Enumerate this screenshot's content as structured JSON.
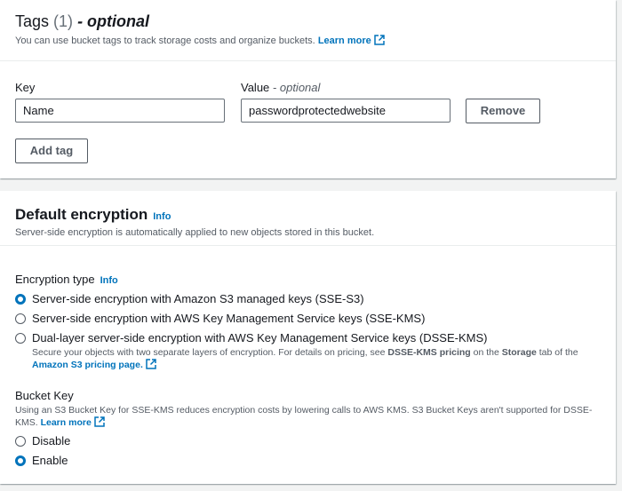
{
  "tags": {
    "title": "Tags",
    "count": "(1)",
    "optional": "- optional",
    "description": "You can use bucket tags to track storage costs and organize buckets.",
    "learn_more": "Learn more",
    "key_label": "Key",
    "value_label": "Value",
    "value_optional": "- optional",
    "rows": [
      {
        "key": "Name",
        "value": "passwordprotectedwebsite",
        "remove_label": "Remove"
      }
    ],
    "add_tag_label": "Add tag"
  },
  "encryption": {
    "title": "Default encryption",
    "info": "Info",
    "description": "Server-side encryption is automatically applied to new objects stored in this bucket.",
    "type_label": "Encryption type",
    "type_info": "Info",
    "options": [
      {
        "label": "Server-side encryption with Amazon S3 managed keys (SSE-S3)",
        "selected": true
      },
      {
        "label": "Server-side encryption with AWS Key Management Service keys (SSE-KMS)",
        "selected": false
      },
      {
        "label": "Dual-layer server-side encryption with AWS Key Management Service keys (DSSE-KMS)",
        "selected": false
      }
    ],
    "dsse_desc_prefix": "Secure your objects with two separate layers of encryption. For details on pricing, see ",
    "dsse_pricing": "DSSE-KMS pricing",
    "dsse_desc_mid": " on the ",
    "dsse_storage": "Storage",
    "dsse_desc_suffix": " tab of the ",
    "pricing_page": "Amazon S3 pricing page.",
    "bucket_key_label": "Bucket Key",
    "bucket_key_desc": "Using an S3 Bucket Key for SSE-KMS reduces encryption costs by lowering calls to AWS KMS. S3 Bucket Keys aren't supported for DSSE-KMS.",
    "bucket_key_learn_more": "Learn more",
    "bucket_key_options": [
      {
        "label": "Disable",
        "selected": false
      },
      {
        "label": "Enable",
        "selected": true
      }
    ]
  },
  "colors": {
    "link": "#0073bb",
    "selected_radio": "#0073bb",
    "background": "#f2f3f3"
  }
}
